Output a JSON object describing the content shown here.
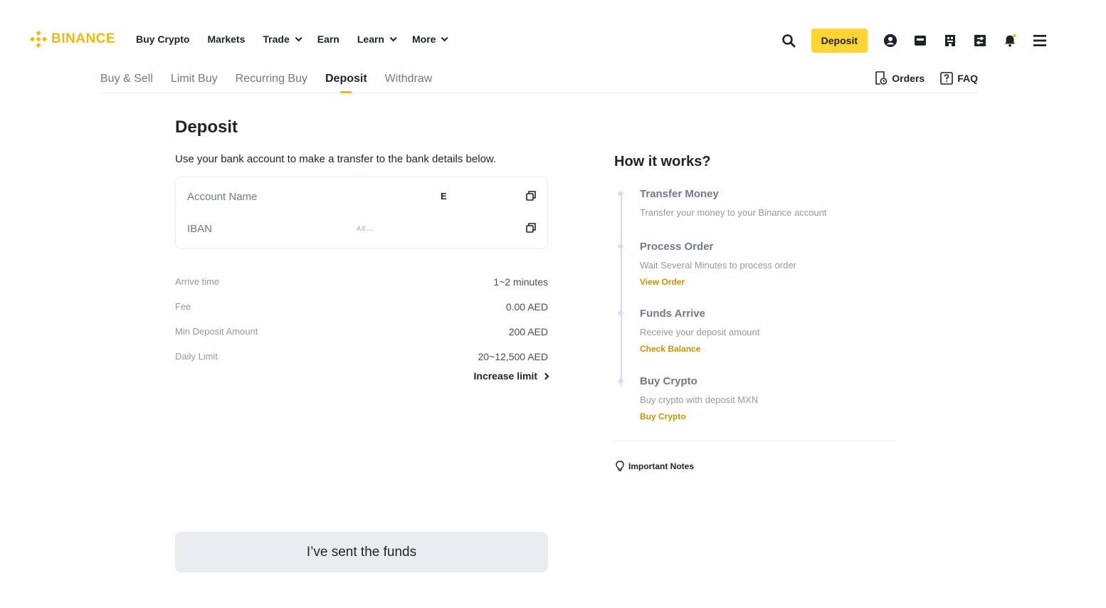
{
  "brand": {
    "name": "BINANCE",
    "accent": "#f0b90b"
  },
  "nav": {
    "items": [
      {
        "label": "Buy Crypto",
        "dropdown": false
      },
      {
        "label": "Markets",
        "dropdown": false
      },
      {
        "label": "Trade",
        "dropdown": true
      },
      {
        "label": "Earn",
        "dropdown": false
      },
      {
        "label": "Learn",
        "dropdown": true
      },
      {
        "label": "More",
        "dropdown": true
      }
    ],
    "deposit_label": "Deposit"
  },
  "subnav": {
    "tabs": [
      {
        "label": "Buy & Sell",
        "active": false
      },
      {
        "label": "Limit Buy",
        "active": false
      },
      {
        "label": "Recurring Buy",
        "active": false
      },
      {
        "label": "Deposit",
        "active": true
      },
      {
        "label": "Withdraw",
        "active": false
      }
    ],
    "orders_label": "Orders",
    "faq_label": "FAQ"
  },
  "deposit": {
    "title": "Deposit",
    "intro": "Use your bank account to make a transfer to the bank details below.",
    "bank": {
      "account_name_label": "Account Name",
      "account_name_value": "E",
      "iban_label": "IBAN",
      "iban_value": "AE..."
    },
    "info": [
      {
        "label": "Arrive time",
        "value": "1~2 minutes"
      },
      {
        "label": "Fee",
        "value": "0.00 AED"
      },
      {
        "label": "Min Deposit Amount",
        "value": "200 AED"
      },
      {
        "label": "Daily Limit",
        "value": "20~12,500 AED"
      }
    ],
    "increase_limit": "Increase limit",
    "sent_button": "I’ve sent the funds"
  },
  "how_it_works": {
    "title": "How it works?",
    "steps": [
      {
        "title": "Transfer Money",
        "desc": "Transfer your money to your Binance account",
        "link": ""
      },
      {
        "title": "Process Order",
        "desc": "Wait Several Minutes to process order",
        "link": "View Order"
      },
      {
        "title": "Funds Arrive",
        "desc": "Receive your deposit amount",
        "link": "Check Balance"
      },
      {
        "title": "Buy Crypto",
        "desc": "Buy crypto with deposit MXN",
        "link": "Buy Crypto"
      }
    ],
    "notes_label": "Important Notes"
  }
}
